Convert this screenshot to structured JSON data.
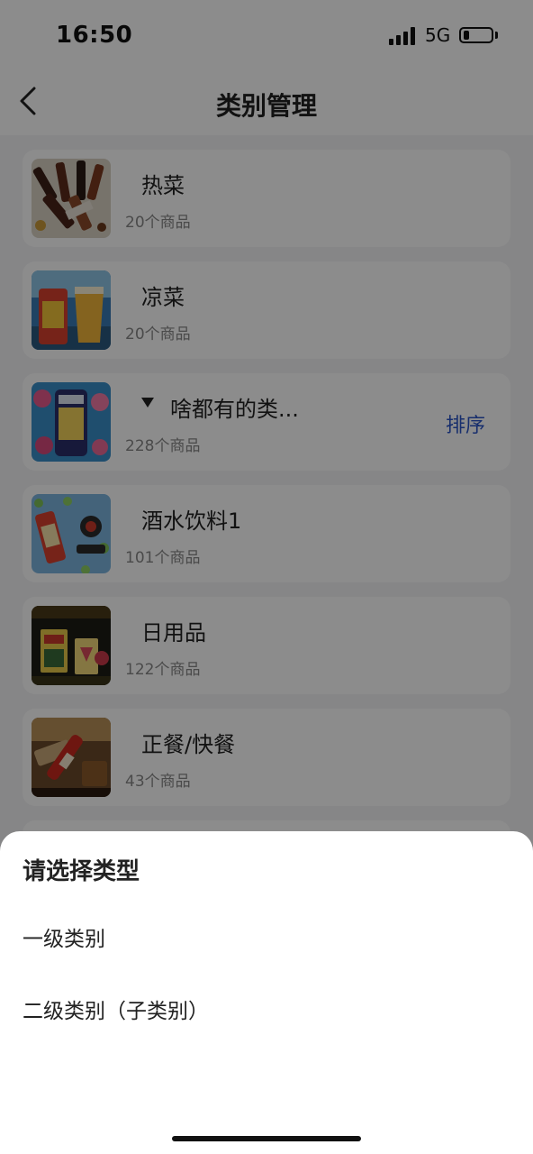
{
  "status": {
    "time": "16:50",
    "network": "5G"
  },
  "nav": {
    "title": "类别管理"
  },
  "categories": [
    {
      "name": "热菜",
      "count": "20个商品"
    },
    {
      "name": "凉菜",
      "count": "20个商品"
    },
    {
      "name": "啥都有的类...",
      "count": "228个商品",
      "sort_label": "排序"
    },
    {
      "name": "酒水饮料1",
      "count": "101个商品"
    },
    {
      "name": "日用品",
      "count": "122个商品"
    },
    {
      "name": "正餐/快餐",
      "count": "43个商品"
    }
  ],
  "sheet": {
    "title": "请选择类型",
    "options": [
      "一级类别",
      "二级类别（子类别）"
    ]
  }
}
